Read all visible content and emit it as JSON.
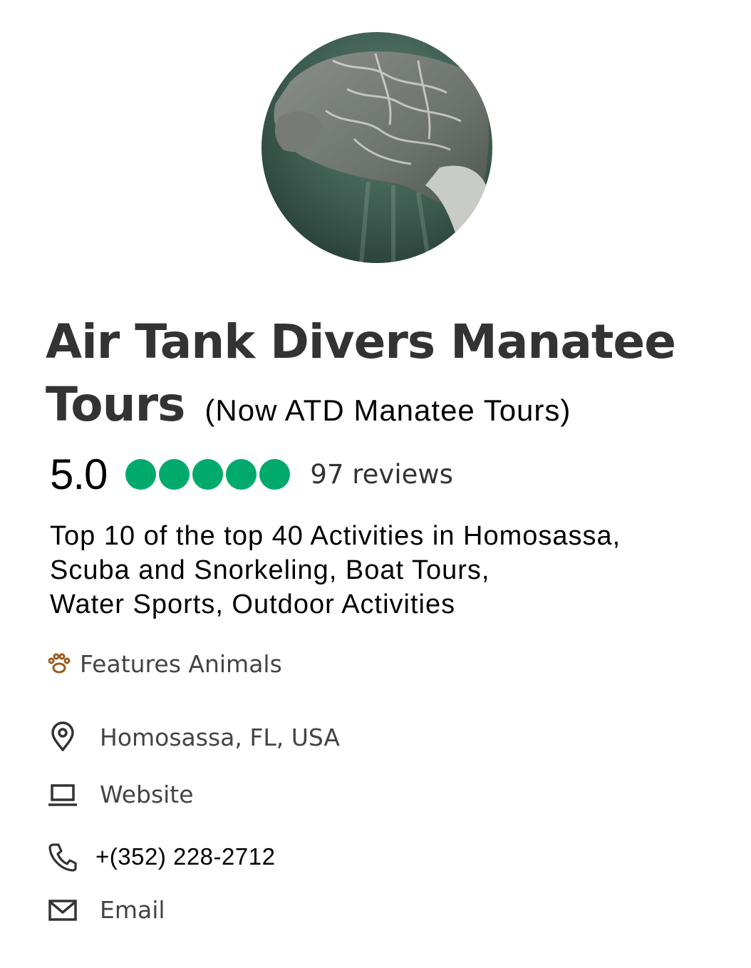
{
  "listing": {
    "title": "Air Tank Divers Manatee Tours",
    "title_suffix": "(Now ATD Manatee Tours)",
    "rating": "5.0",
    "rating_bubbles": 5,
    "rating_color": "#00aa6c",
    "review_count": "97 reviews",
    "categories": [
      "Top 10 of the top 40 Activities in Homosassa,",
      "Scuba and Snorkeling, Boat Tours,",
      "Water Sports, Outdoor Activities"
    ],
    "feature": {
      "icon": "paw-icon",
      "label": "Features Animals"
    }
  },
  "contact": {
    "location": {
      "icon": "map-pin-icon",
      "label": "Homosassa, FL, USA"
    },
    "website": {
      "icon": "laptop-icon",
      "label": "Website"
    },
    "phone": {
      "icon": "phone-icon",
      "label": "+(352) 228-2712"
    },
    "email": {
      "icon": "envelope-icon",
      "label": "Email"
    }
  }
}
